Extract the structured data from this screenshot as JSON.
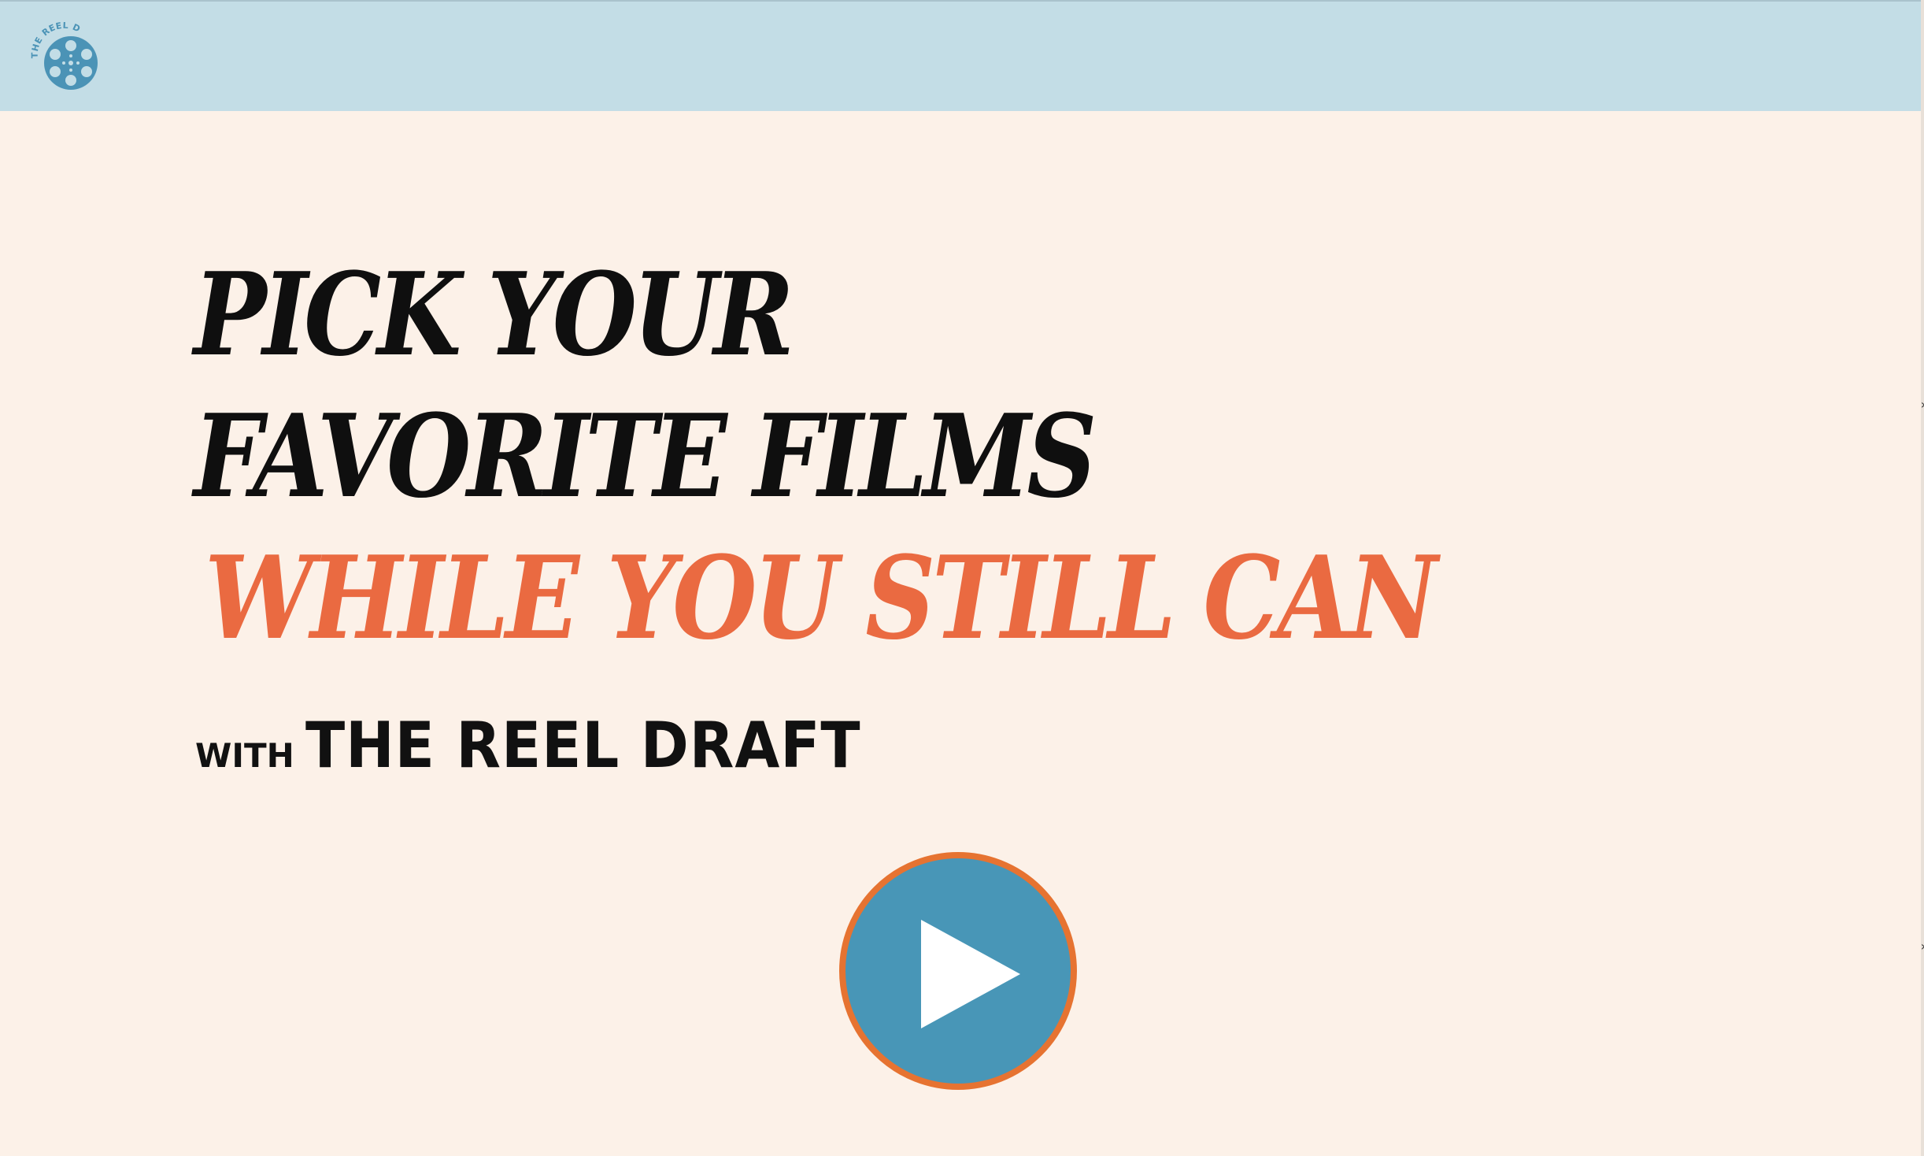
{
  "header": {
    "logo_text": "THE REEL DRAFT",
    "logo_icon": "film-reel-icon"
  },
  "hero": {
    "line1": "PICK YOUR",
    "line2": "FAVORITE FILMS",
    "line3": "WHILE YOU STILL CAN"
  },
  "byline": {
    "with": "WITH",
    "brand": "THE REEL DRAFT"
  },
  "play_button": {
    "icon": "play-icon"
  },
  "colors": {
    "page_background": "#fcf1e8",
    "header_background": "#c3dde6",
    "accent_orange": "#ea6a41",
    "play_blue": "#4896b7",
    "play_ring": "#e67331",
    "text_black": "#0f0f0f"
  }
}
